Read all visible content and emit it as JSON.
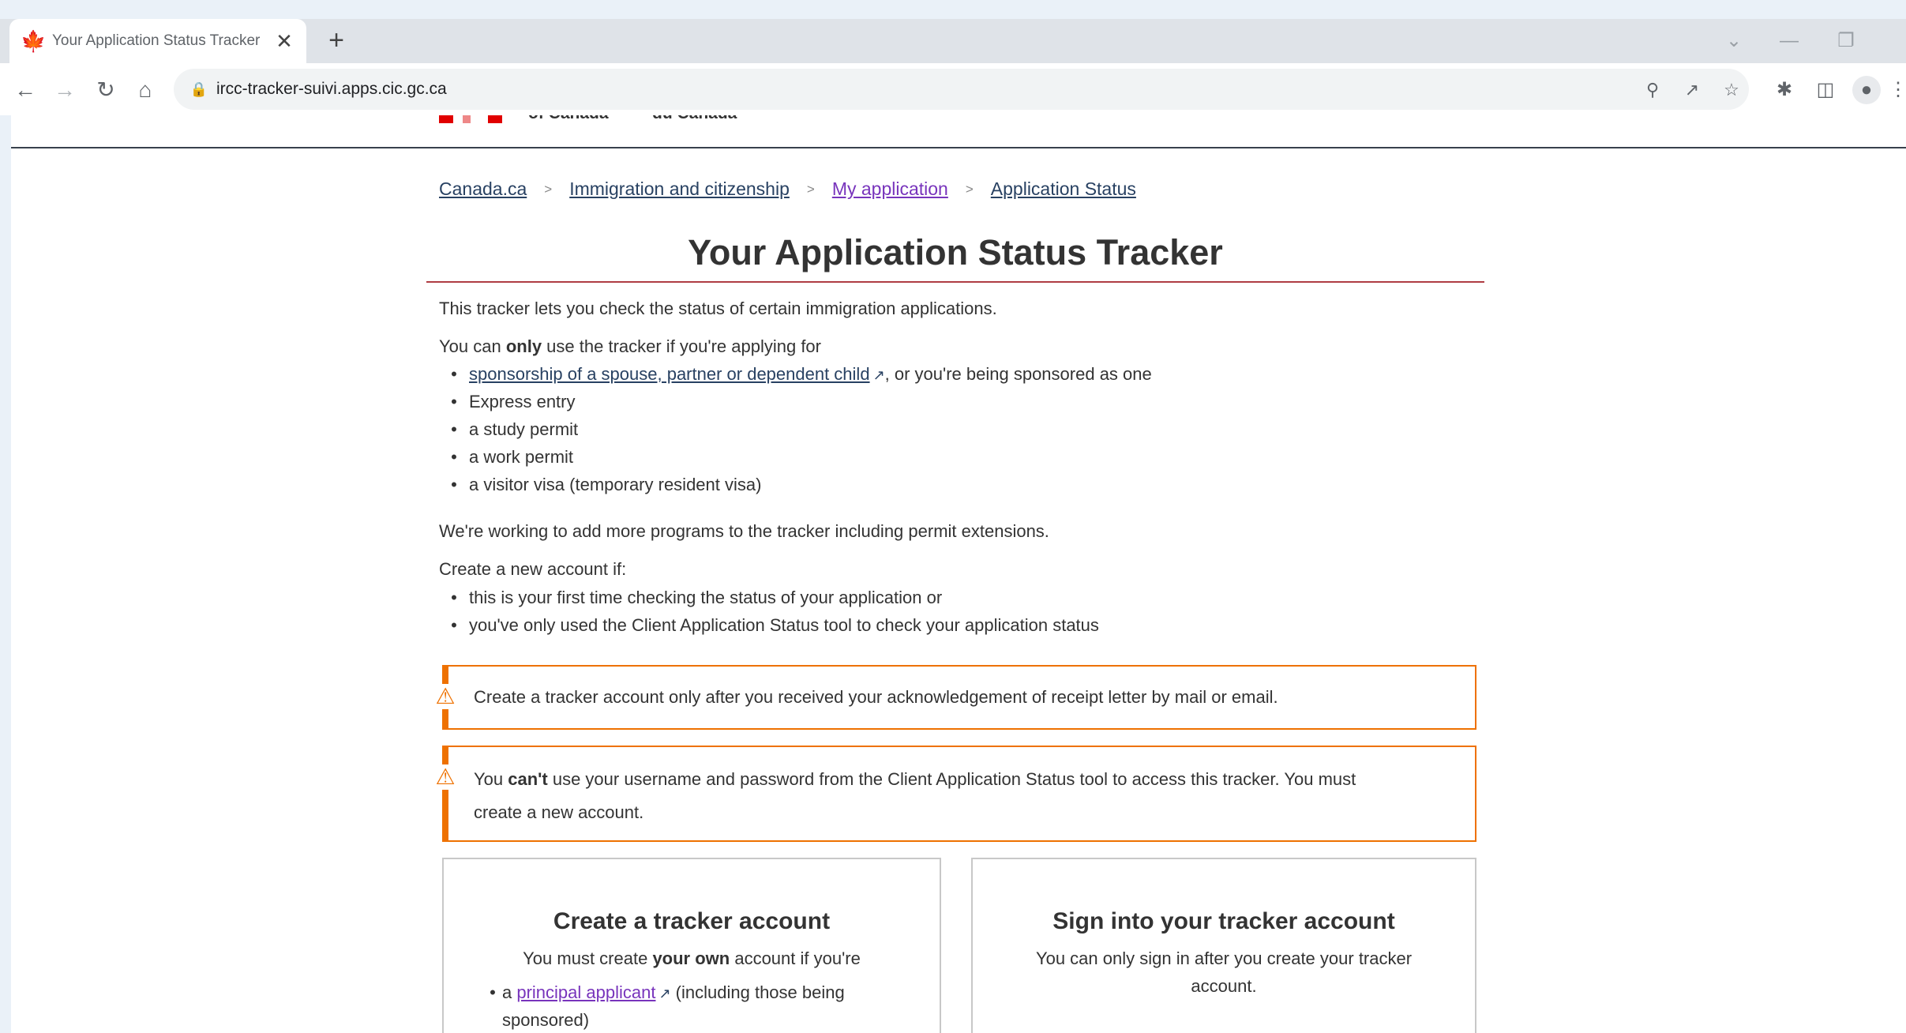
{
  "browser": {
    "tab_title": "Your Application Status Tracker",
    "url": "ircc-tracker-suivi.apps.cic.gc.ca",
    "icons": [
      "maple-leaf-icon",
      "close-icon",
      "plus-icon",
      "back-icon",
      "forward-icon",
      "reload-icon",
      "home-icon",
      "lock-icon",
      "zoom-icon",
      "share-icon",
      "star-icon",
      "extensions-icon",
      "sidepanel-icon",
      "profile-icon",
      "menu-icon",
      "chevron-down-icon",
      "minimize-icon",
      "restore-icon"
    ]
  },
  "header": {
    "gov_en": "of Canada",
    "gov_fr": "du Canada"
  },
  "breadcrumbs": [
    "Canada.ca",
    "Immigration and citizenship",
    "My application",
    "Application Status"
  ],
  "page": {
    "title": "Your Application Status Tracker",
    "intro": "This tracker lets you check the status of certain immigration applications.",
    "only_before": "You can ",
    "only_bold": "only",
    "only_after": " use the tracker if you're applying for",
    "programs_link": "sponsorship of a spouse, partner or dependent child",
    "programs_link_after": ", or you're being sponsored as one",
    "programs": [
      "Express entry",
      "a study permit",
      "a work permit",
      "a visitor visa (temporary resident visa)"
    ],
    "working": "We're working to add more programs to the tracker including permit extensions.",
    "create_if": "Create a new account if:",
    "create_reasons": [
      "this is your first time checking the status of your application or",
      "you've only used the Client Application Status tool to check your application status"
    ]
  },
  "alerts": {
    "a1": "Create a tracker account only after you received your acknowledgement of receipt letter by mail or email.",
    "a2_before": "You ",
    "a2_bold": "can't",
    "a2_after": " use your username and password from the Client Application Status tool to access this tracker. You must",
    "a2_line2": "create a new account."
  },
  "cards": {
    "create": {
      "title": "Create a tracker account",
      "text_before": "You must create ",
      "text_bold": "your own",
      "text_after": " account if you're",
      "item_prefix": "a ",
      "item_link": "principal applicant",
      "item_after": " (including those being",
      "item_line2": "sponsored)"
    },
    "signin": {
      "title": "Sign into your tracker account",
      "text_line1": "You can only sign in after you create your tracker",
      "text_line2": "account."
    }
  }
}
